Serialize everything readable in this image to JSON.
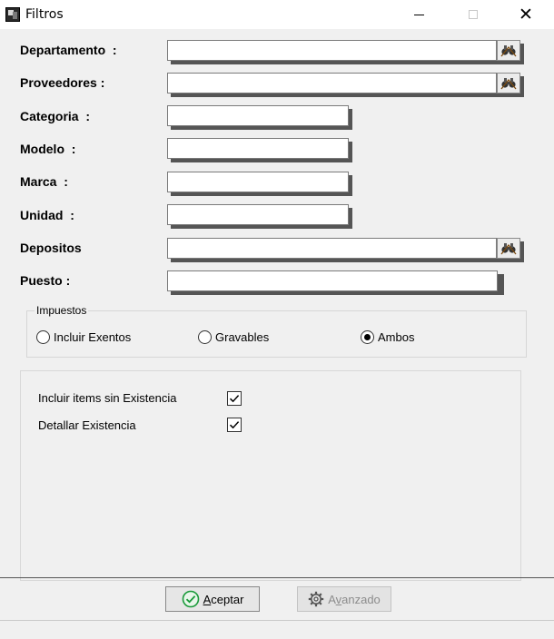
{
  "window": {
    "title": "Filtros",
    "minimize_glyph": "",
    "close_glyph": "✕"
  },
  "fields": [
    {
      "label": "Departamento  :",
      "value": "",
      "has_lookup": true
    },
    {
      "label": "Proveedores :",
      "value": "",
      "has_lookup": true
    },
    {
      "label": "Categoria  :",
      "value": "",
      "has_lookup": false
    },
    {
      "label": "Modelo  :",
      "value": "",
      "has_lookup": false
    },
    {
      "label": "Marca  :",
      "value": "",
      "has_lookup": false
    },
    {
      "label": "Unidad  :",
      "value": "",
      "has_lookup": false
    },
    {
      "label": "Depositos",
      "value": "",
      "has_lookup": true
    },
    {
      "label": "Puesto :",
      "value": "",
      "has_lookup": false
    }
  ],
  "impuestos": {
    "title": "Impuestos",
    "options": [
      {
        "label": "Incluir Exentos",
        "checked": false
      },
      {
        "label": "Gravables",
        "checked": false
      },
      {
        "label": "Ambos",
        "checked": true
      }
    ]
  },
  "options": {
    "items": [
      {
        "label": "Incluir items sin Existencia",
        "checked": true
      },
      {
        "label": "Detallar Existencia",
        "checked": true
      }
    ]
  },
  "buttons": {
    "accept": {
      "label_first": "A",
      "label_rest": "ceptar",
      "icon": "check-circle-icon"
    },
    "advanced": {
      "label_first": "A",
      "label_mid": "v",
      "label_rest": "anzado",
      "icon": "gear-icon",
      "enabled": false
    }
  },
  "colors": {
    "accept_icon": "#1a9a3a",
    "disabled_text": "#8c8c8c"
  }
}
